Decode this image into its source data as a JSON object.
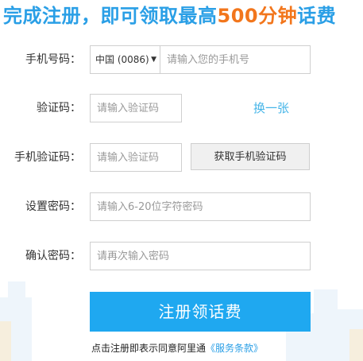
{
  "headline": {
    "part1": "完成注册，即可领取最高",
    "highlight": "500分钟",
    "part2": "话费",
    "color_primary": "#2a9fe6",
    "color_highlight": "#f2761c"
  },
  "form": {
    "phone": {
      "label": "手机号码：",
      "country_code": "中国 (0086)",
      "placeholder": "请输入您的手机号"
    },
    "captcha": {
      "label": "验证码：",
      "placeholder": "请输入验证码",
      "refresh_label": "换一张"
    },
    "sms_code": {
      "label": "手机验证码：",
      "placeholder": "请输入验证码",
      "button_label": "获取手机验证码"
    },
    "password": {
      "label": "设置密码：",
      "placeholder": "请输入6-20位字符密码"
    },
    "confirm_password": {
      "label": "确认密码：",
      "placeholder": "请再次输入密码"
    }
  },
  "submit": {
    "label": "注册领话费",
    "color": "#1fa8f0"
  },
  "agreement": {
    "prefix": "点击注册即表示同意阿里通",
    "link_label": "《服务条款》"
  },
  "icons": {
    "country_dropdown": "caret-down-icon"
  }
}
